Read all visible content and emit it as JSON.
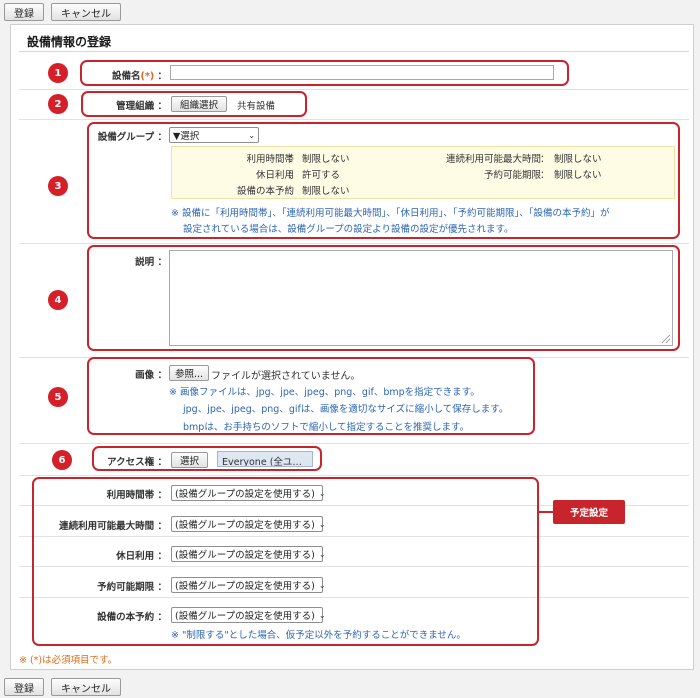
{
  "toolbar": {
    "register": "登録",
    "cancel": "キャンセル"
  },
  "form": {
    "title": "設備情報の登録",
    "name_label": "設備名",
    "required_mark": "(*)",
    "colon": "：",
    "org_label": "管理組織",
    "org_button": "組織選択",
    "org_value": "共有設備",
    "group_label": "設備グループ",
    "group_select": "▼選択",
    "group_info": {
      "usage_time_label": "利用時間帯",
      "usage_time_value": "制限しない",
      "max_continuous_label": "連続利用可能最大時間",
      "max_continuous_value": "制限しない",
      "holiday_label": "休日利用",
      "holiday_value": "許可する",
      "period_label": "予約可能期限",
      "period_value": "制限しない",
      "main_reservation_label": "設備の本予約",
      "main_reservation_value": "制限しない"
    },
    "group_note_1": "※ 設備に「利用時間帯」、「連続利用可能最大時間」、「休日利用」、「予約可能期限」、「設備の本予約」が",
    "group_note_2": "設定されている場合は、設備グループの設定より設備の設定が優先されます。",
    "desc_label": "説明",
    "image_label": "画像",
    "image_browse": "参照...",
    "image_status": "ファイルが選択されていません。",
    "image_note_1": "※ 画像ファイルは、jpg、jpe、jpeg、png、gif、bmpを指定できます。",
    "image_note_2": "jpg、jpe、jpeg、png、gifは、画像を適切なサイズに縮小して保存します。",
    "image_note_3": "bmpは、お手持ちのソフトで縮小して指定することを推奨します。",
    "access_label": "アクセス権",
    "access_button": "選択",
    "access_value": "Everyone (全ユ…",
    "schedule": {
      "usage_time_label": "利用時間帯",
      "max_continuous_label": "連続利用可能最大時間",
      "holiday_label": "休日利用",
      "period_label": "予約可能期限",
      "main_reservation_label": "設備の本予約",
      "select_value": "(設備グループの設定を使用する)",
      "note": "※ \"制限する\"とした場合、仮予定以外を予約することができません。",
      "badge": "予定設定"
    },
    "required_note": "※ (*)は必須項目です。"
  },
  "badges": [
    "1",
    "2",
    "3",
    "4",
    "5",
    "6"
  ],
  "colors": {
    "annotation_red": "#c8242b",
    "note_blue": "#2e65b5",
    "required_orange": "#e06a1b"
  }
}
